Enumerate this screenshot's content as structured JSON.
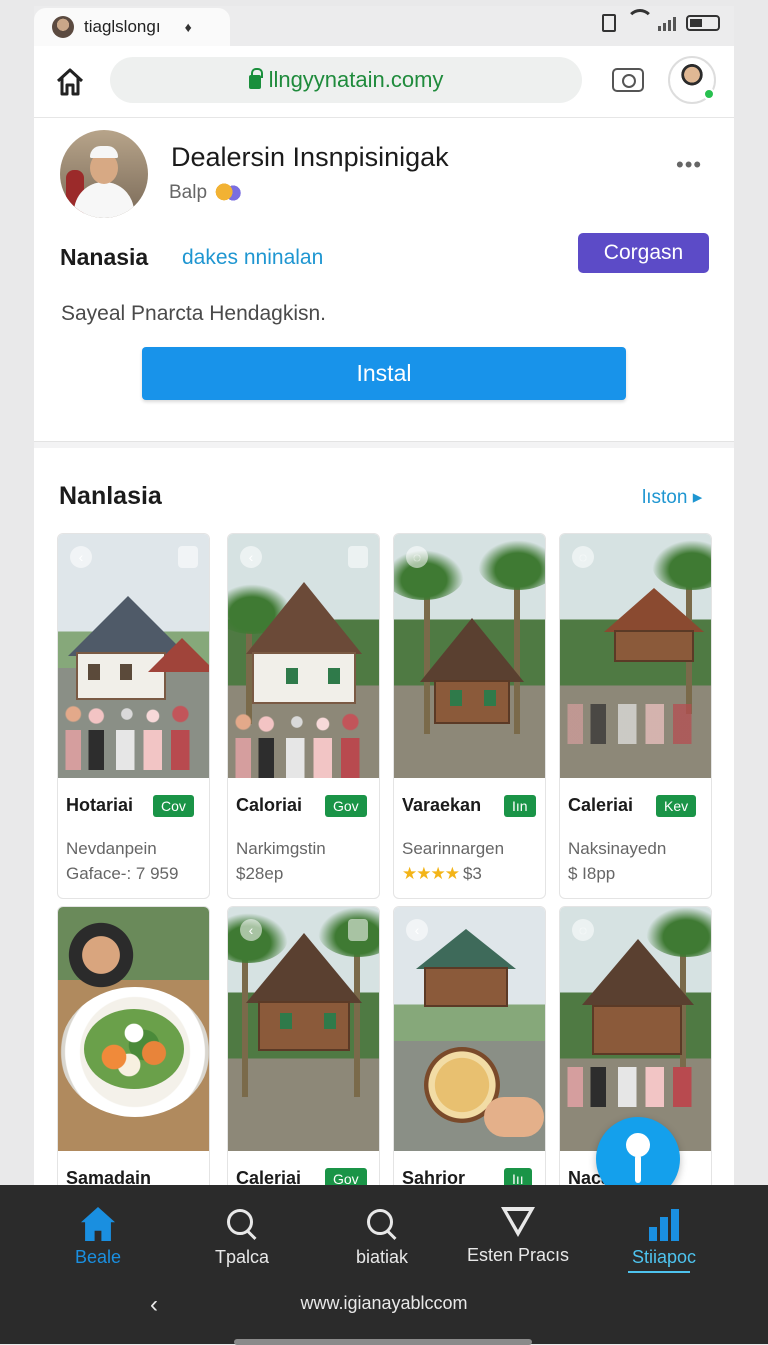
{
  "tab": {
    "title": "tiaglslongı",
    "close": "♦"
  },
  "address_bar": {
    "url": "llngyynatain.comy"
  },
  "profile": {
    "name": "Dealersin Insnpisinigak",
    "sub": "Balp",
    "more": "•••",
    "label": "Nanasia",
    "link": "dakes nninalan",
    "follow_label": "Corgasn",
    "description": "Sayeal Pnarcta Hendagkisn.",
    "install_label": "Instal"
  },
  "section": {
    "title": "Nanlasia",
    "more": "lıston ▸",
    "cards": [
      {
        "title": "Hotariai",
        "badge": "Cov",
        "line1": "Nevdanpein",
        "line2": "Gaface-: 7 959"
      },
      {
        "title": "Caloriai",
        "badge": "Gov",
        "line1": "Narkimgstin",
        "line2": "$28ep"
      },
      {
        "title": "Varaekan",
        "badge": "Iın",
        "line1": "Searinnargen",
        "line2": "$3",
        "stars": "★★★★"
      },
      {
        "title": "Caleriai",
        "badge": "Kev",
        "line1": "Naksinayedn",
        "line2": "$ I8pp"
      },
      {
        "title": "Samadain",
        "badge": "",
        "line1": "",
        "line2": ""
      },
      {
        "title": "Caleriai",
        "badge": "Gov",
        "line1": "",
        "line2": ""
      },
      {
        "title": "Sahrior",
        "badge": "Iıı",
        "line1": "",
        "line2": ""
      },
      {
        "title": "Nacarie",
        "badge": "",
        "line1": "",
        "line2": ""
      }
    ]
  },
  "bottom_nav": {
    "items": [
      {
        "label": "Beale",
        "icon": "home-icon"
      },
      {
        "label": "Tpalca",
        "icon": "search-icon"
      },
      {
        "label": "biatiak",
        "icon": "search-icon"
      },
      {
        "label": "Esten Pracıs",
        "icon": "filter-icon"
      },
      {
        "label": "Stiiapoc",
        "icon": "stats-icon"
      }
    ],
    "url": "www.igianayablccom",
    "back": "‹"
  },
  "colors": {
    "primary": "#1893ea",
    "follow": "#5c4bc7",
    "badge": "#1a9447",
    "link": "#1f96d1",
    "nav_bg": "#2b2b2b"
  }
}
